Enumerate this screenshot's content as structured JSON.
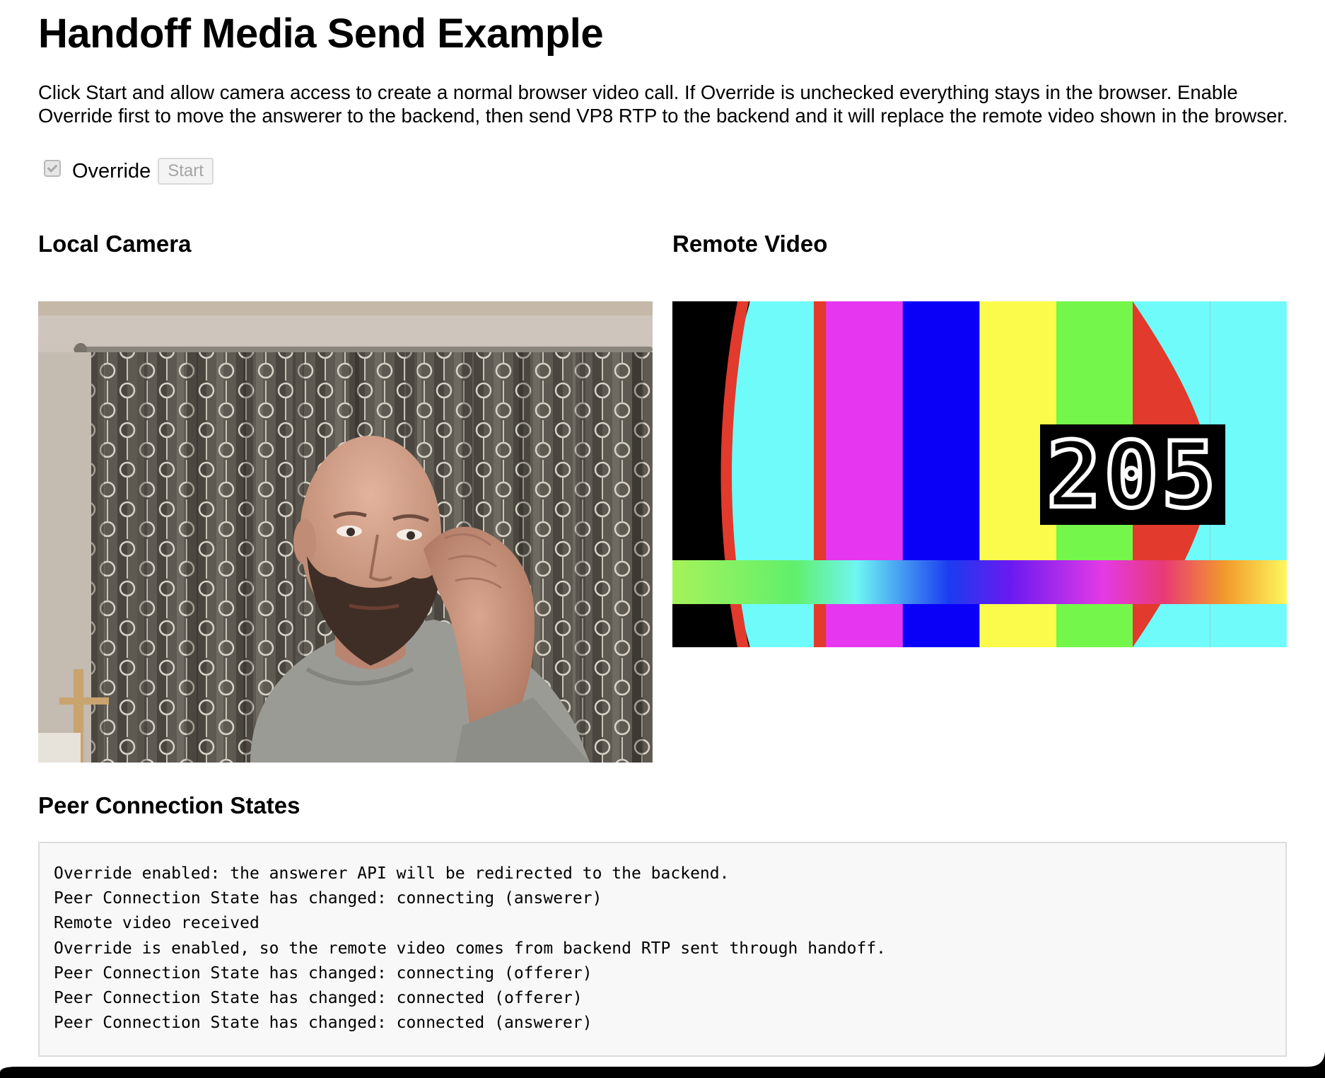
{
  "page": {
    "title": "Handoff Media Send Example",
    "description": "Click Start and allow camera access to create a normal browser video call. If Override is unchecked everything stays in the browser. Enable Override first to move the answerer to the backend, then send VP8 RTP to the backend and it will replace the remote video shown in the browser."
  },
  "controls": {
    "override_label": "Override",
    "override_checked": true,
    "override_disabled": true,
    "start_label": "Start",
    "start_disabled": true
  },
  "local": {
    "heading": "Local Camera"
  },
  "remote": {
    "heading": "Remote Video",
    "frame_counter": "205",
    "bar_colors": [
      "#000000",
      "#e23a2d",
      "#e636f0",
      "#0a00f7",
      "#fbfb4c",
      "#75f64a",
      "#e23a2d",
      "#6ffbfa"
    ]
  },
  "states": {
    "heading": "Peer Connection States",
    "log": [
      "Override enabled: the answerer API will be redirected to the backend.",
      "Peer Connection State has changed: connecting (answerer)",
      "Remote video received",
      "Override is enabled, so the remote video comes from backend RTP sent through handoff.",
      "Peer Connection State has changed: connecting (offerer)",
      "Peer Connection State has changed: connected (offerer)",
      "Peer Connection State has changed: connected (answerer)"
    ]
  }
}
